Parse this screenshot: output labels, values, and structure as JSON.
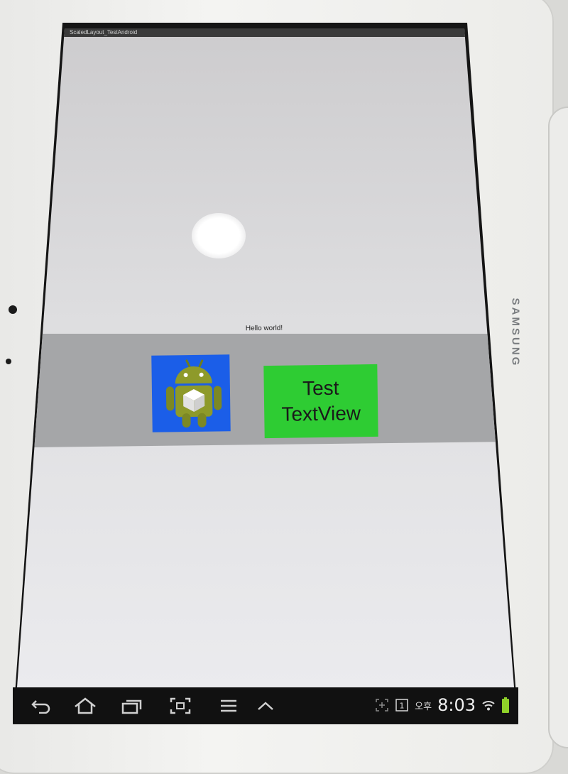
{
  "device": {
    "brand": "SAMSUNG"
  },
  "app": {
    "title": "ScaledLayout_TestAndroid",
    "hello_text": "Hello world!",
    "image_view": {
      "icon": "android-robot-icon",
      "background": "#1b5ee8"
    },
    "text_view": {
      "line1": "Test",
      "line2": "TextView",
      "background": "#2ecc33"
    },
    "band_color": "#a5a6a8"
  },
  "navbar": {
    "buttons": [
      "back-icon",
      "home-icon",
      "recent-apps-icon",
      "screenshot-icon",
      "menu-icon",
      "hide-keyboard-icon"
    ],
    "status": {
      "ampm": "오후",
      "time": "8:03",
      "notification_badge": "1"
    }
  }
}
